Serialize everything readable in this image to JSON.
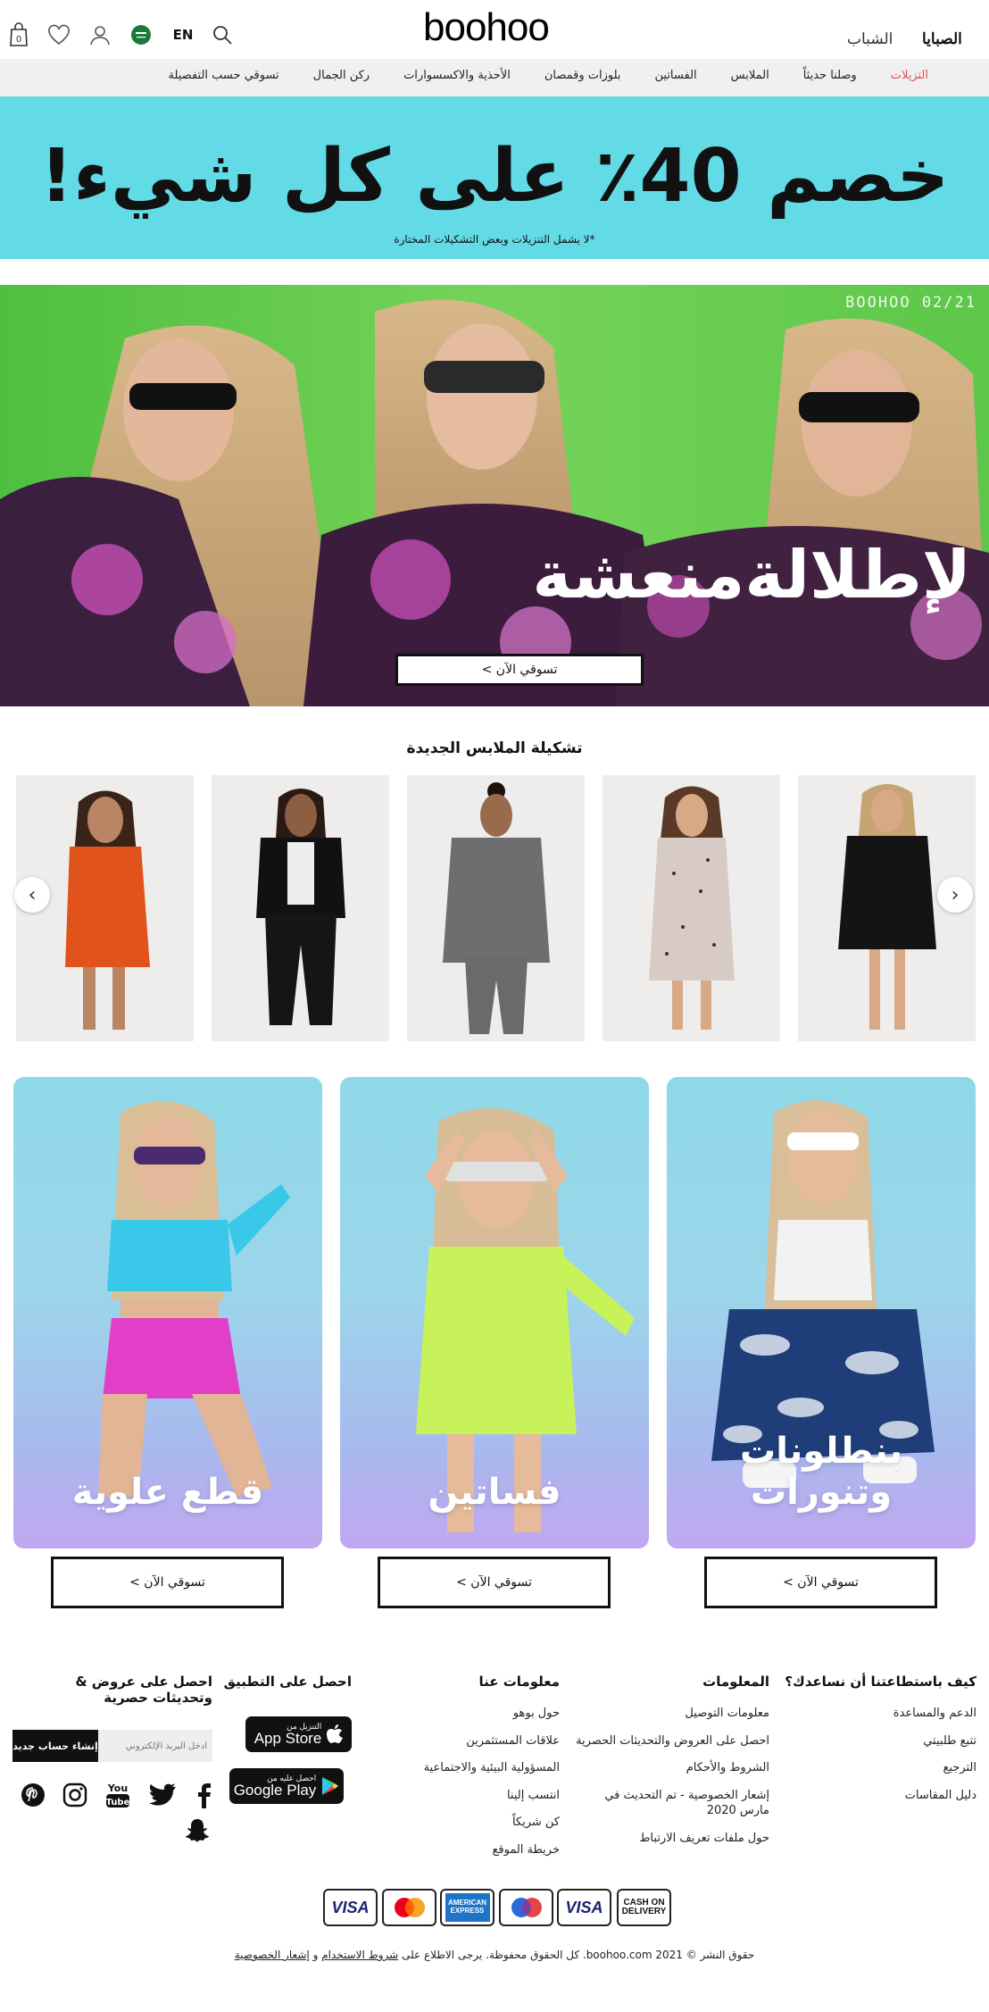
{
  "header": {
    "cart_count": "0",
    "language": "EN",
    "logo": "boohoo",
    "nav_women": "الصبايا",
    "nav_men": "الشباب"
  },
  "categories": [
    "التزيلات",
    "وصلنا حديثاً",
    "الملابس",
    "الفساتين",
    "بلوزات وقمصان",
    "الأحذية والاكسسوارات",
    "ركن الجمال",
    "تسوقي حسب التفصيلة"
  ],
  "promo": {
    "title": "خصم 40٪ على كل شيء!",
    "note": "*لا يشمل التنزيلات وبعض التشكيلات المختارة",
    "bg_color": "#62dbe6"
  },
  "hero": {
    "date_stamp": "BOOHOO 02/21",
    "title": "لإطلالةمنعشة",
    "button": "تسوقي الآن >",
    "bg_color": "#5fc84a"
  },
  "new_in": {
    "title": "تشكيلة الملابس الجديدة",
    "prev_icon": "chevron-left-icon",
    "next_icon": "chevron-right-icon"
  },
  "category_cards": [
    {
      "label": "بنطلونات وتنورات",
      "button": "تسوقي الآن >"
    },
    {
      "label": "فساتين",
      "button": "تسوقي الآن >"
    },
    {
      "label": "قطع علوية",
      "button": "تسوقي الآن >"
    }
  ],
  "footer": {
    "help": {
      "title": "كيف باستطاعتنا أن نساعدك؟",
      "links": [
        "الدعم والمساعدة",
        "تتبع طلبيتي",
        "الترجيع",
        "دليل المقاسات"
      ]
    },
    "info": {
      "title": "المعلومات",
      "links": [
        "معلومات التوصيل",
        "احصل على العروض والتحديثات الحصرية",
        "الشروط والأحكام",
        "إشعار الخصوصية - تم التحديث في مارس 2020",
        "حول ملفات تعريف الارتباط"
      ]
    },
    "about": {
      "title": "معلومات عنا",
      "links": [
        "حول بوهو",
        "علاقات المستثمرين",
        "المسؤولية البيئية والاجتماعية",
        "انتسب إلينا",
        "كن شريكاً",
        "خريطة الموقع"
      ]
    },
    "app": {
      "title": "احصل على التطبيق",
      "appstore_small": "التنزيل من",
      "appstore_big": "App Store",
      "gplay_small": "احصل عليه من",
      "gplay_big": "Google Play"
    },
    "newsletter": {
      "title": "احصل على عروض & وتحديثات حصرية",
      "placeholder": "أدخل البريد الإلكتروني",
      "button": "إنشاء حساب جديد"
    },
    "social": [
      "facebook-icon",
      "twitter-icon",
      "youtube-icon",
      "instagram-icon",
      "pinterest-icon",
      "snapchat-icon"
    ],
    "payments": [
      "CASH ON DELIVERY",
      "VISA",
      "Maestro",
      "AMERICAN EXPRESS",
      "Mastercard",
      "VISA"
    ],
    "copyright_text": "حقوق النشر © 2021 boohoo.com. كل الحقوق محفوظة. يرجى الاطلاع على",
    "terms_link": "شروط الاستخدام",
    "and": "و",
    "privacy_link": "إشعار الخصوصية"
  }
}
